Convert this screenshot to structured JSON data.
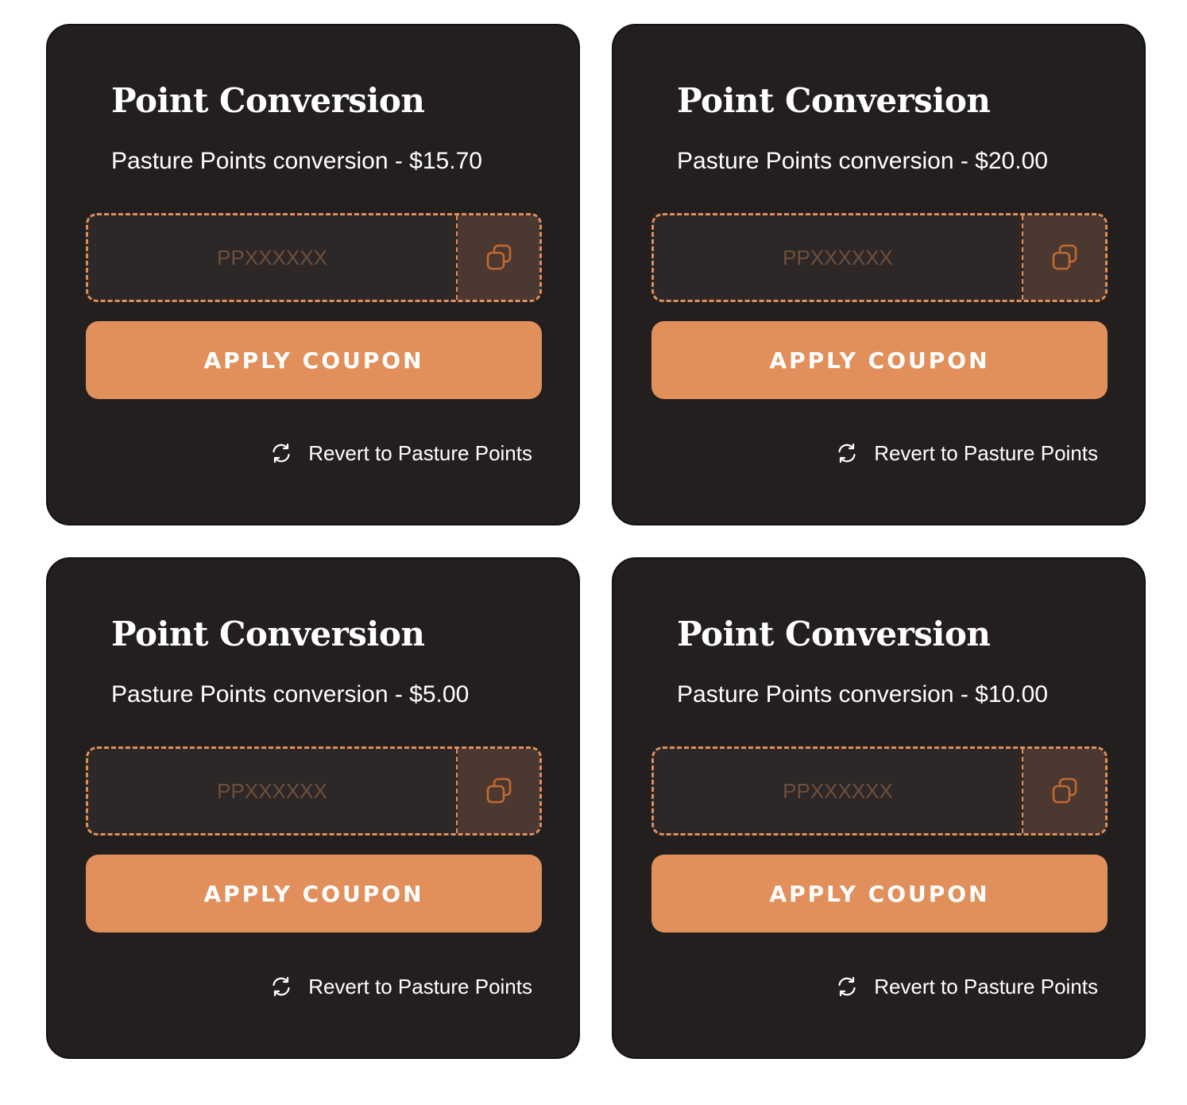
{
  "colors": {
    "card_background": "#231f1e",
    "accent": "#e1905c",
    "coupon_code_text": "#6e4f3c",
    "copy_button_background": "#4a3831",
    "text": "#ffffff"
  },
  "icons": {
    "copy": "copy-icon",
    "revert": "refresh-icon"
  },
  "cards": [
    {
      "title": "Point Conversion",
      "subtitle": "Pasture Points conversion - $15.70",
      "coupon_code": "PPXXXXXX",
      "apply_label": "APPLY COUPON",
      "revert_label": "Revert to Pasture Points"
    },
    {
      "title": "Point Conversion",
      "subtitle": "Pasture Points conversion - $20.00",
      "coupon_code": "PPXXXXXX",
      "apply_label": "APPLY COUPON",
      "revert_label": "Revert to Pasture Points"
    },
    {
      "title": "Point Conversion",
      "subtitle": "Pasture Points conversion - $5.00",
      "coupon_code": "PPXXXXXX",
      "apply_label": "APPLY COUPON",
      "revert_label": "Revert to Pasture Points"
    },
    {
      "title": "Point Conversion",
      "subtitle": "Pasture Points conversion - $10.00",
      "coupon_code": "PPXXXXXX",
      "apply_label": "APPLY COUPON",
      "revert_label": "Revert to Pasture Points"
    }
  ]
}
